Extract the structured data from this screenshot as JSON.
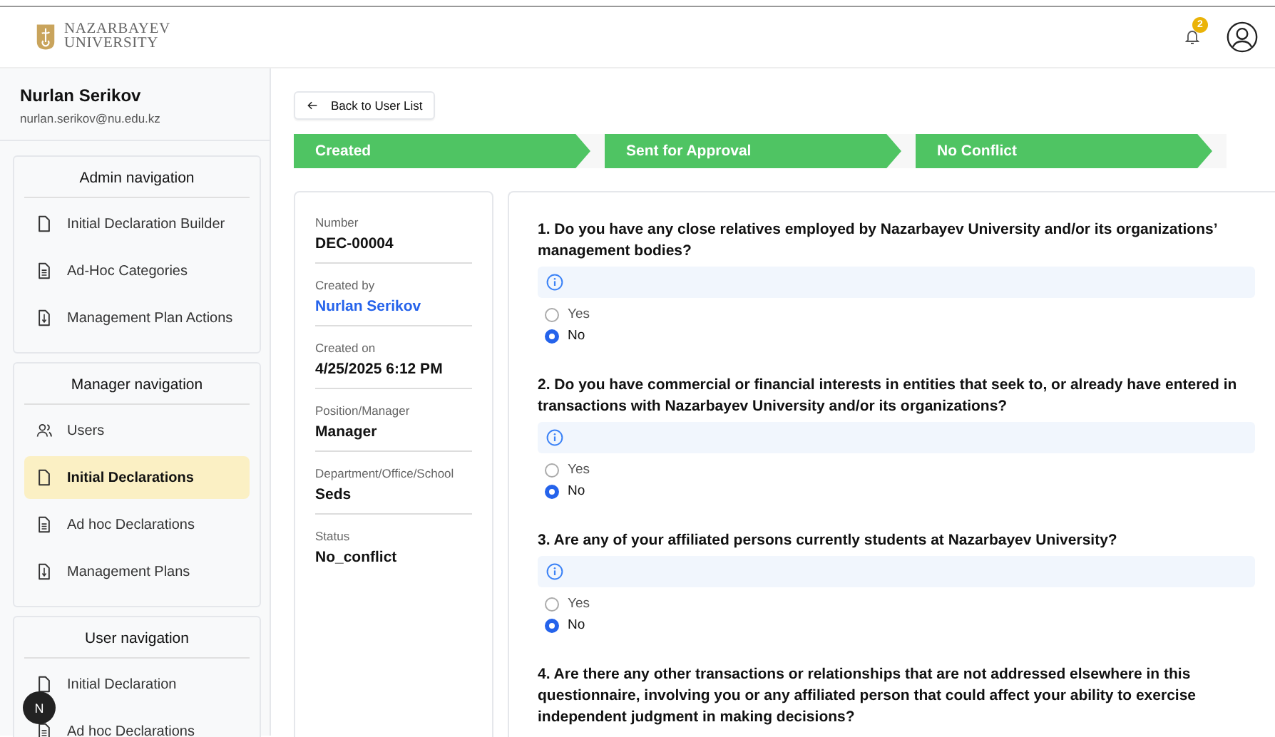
{
  "header": {
    "logo_text": [
      "NAZARBAYEV",
      "UNIVERSITY"
    ],
    "notification_count": "2"
  },
  "sidebar": {
    "user": {
      "name": "Nurlan Serikov",
      "email": "nurlan.serikov@nu.edu.kz"
    },
    "sections": [
      {
        "title": "Admin navigation",
        "items": [
          {
            "label": "Initial Declaration Builder",
            "selected": false
          },
          {
            "label": "Ad-Hoc Categories",
            "selected": false
          },
          {
            "label": "Management Plan Actions",
            "selected": false
          }
        ]
      },
      {
        "title": "Manager navigation",
        "items": [
          {
            "label": "Users",
            "selected": false
          },
          {
            "label": "Initial Declarations",
            "selected": true
          },
          {
            "label": "Ad hoc Declarations",
            "selected": false
          },
          {
            "label": "Management Plans",
            "selected": false
          }
        ]
      },
      {
        "title": "User navigation",
        "items": [
          {
            "label": "Initial Declaration",
            "selected": false
          },
          {
            "label": "Ad hoc Declarations",
            "selected": false
          }
        ]
      }
    ]
  },
  "dev_badge": "N",
  "back_button": "Back to User List",
  "steps": [
    "Created",
    "Sent for Approval",
    "No Conflict"
  ],
  "details": [
    {
      "label": "Number",
      "value": "DEC-00004",
      "kind": "text"
    },
    {
      "label": "Created by",
      "value": "Nurlan Serikov",
      "kind": "link"
    },
    {
      "label": "Created on",
      "value": "4/25/2025 6:12 PM",
      "kind": "text"
    },
    {
      "label": "Position/Manager",
      "value": "Manager",
      "kind": "text"
    },
    {
      "label": "Department/Office/School",
      "value": "Seds",
      "kind": "text"
    },
    {
      "label": "Status",
      "value": "No_conflict",
      "kind": "text"
    }
  ],
  "questions": [
    {
      "text": "1. Do you have any close relatives employed by Nazarbayev University and/or its organizations’ management bodies?",
      "options": [
        {
          "label": "Yes",
          "selected": false
        },
        {
          "label": "No",
          "selected": true
        }
      ]
    },
    {
      "text": "2. Do you have commercial or financial interests in entities that seek to, or already have entered in transactions with Nazarbayev University and/or its organizations?",
      "options": [
        {
          "label": "Yes",
          "selected": false
        },
        {
          "label": "No",
          "selected": true
        }
      ]
    },
    {
      "text": "3. Are any of your affiliated persons currently students at Nazarbayev University?",
      "options": [
        {
          "label": "Yes",
          "selected": false
        },
        {
          "label": "No",
          "selected": true
        }
      ]
    },
    {
      "text": "4. Are there any other transactions or relationships that are not addressed elsewhere in this questionnaire, involving you or any affiliated person that could affect your ability to exercise independent judgment in making decisions?"
    }
  ]
}
